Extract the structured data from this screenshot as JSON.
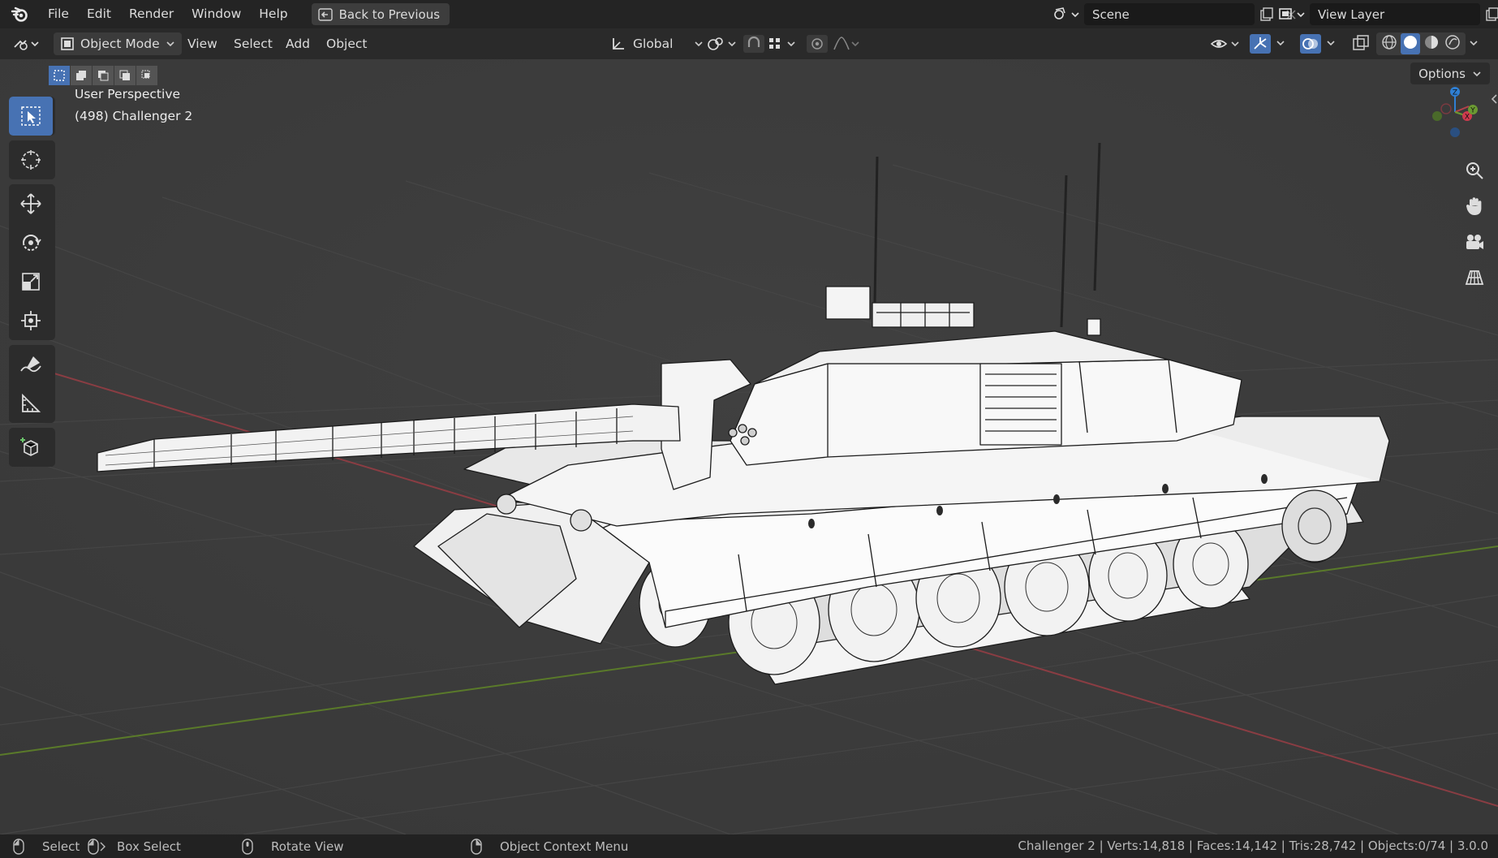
{
  "app": {
    "name": "Blender"
  },
  "topbar": {
    "menus": [
      "File",
      "Edit",
      "Render",
      "Window",
      "Help"
    ],
    "back_button": "Back to Previous",
    "scene_field": "Scene",
    "view_layer_field": "View Layer"
  },
  "header": {
    "mode": "Object Mode",
    "menus": [
      "View",
      "Select",
      "Add",
      "Object"
    ],
    "transform_orientation": "Global"
  },
  "viewport": {
    "perspective_label": "User Perspective",
    "object_label": "(498) Challenger 2",
    "options_button": "Options",
    "gizmo_axes": {
      "z": "Z",
      "x": "X",
      "y": "Y"
    }
  },
  "tools": [
    "select-box",
    "cursor",
    "move",
    "rotate",
    "scale",
    "transform",
    "annotate",
    "measure",
    "add-cube"
  ],
  "statusbar": {
    "select": "Select",
    "box_select": "Box Select",
    "rotate_view": "Rotate View",
    "context_menu": "Object Context Menu",
    "stats": "Challenger 2 | Verts:14,818 | Faces:14,142 | Tris:28,742 | Objects:0/74 | 3.0.0"
  },
  "colors": {
    "accent": "#4772b3",
    "viewport_bg": "#3c3c3c",
    "x_axis": "#b5424a",
    "y_axis": "#6b9a32",
    "z_axis": "#2f7fd3"
  }
}
